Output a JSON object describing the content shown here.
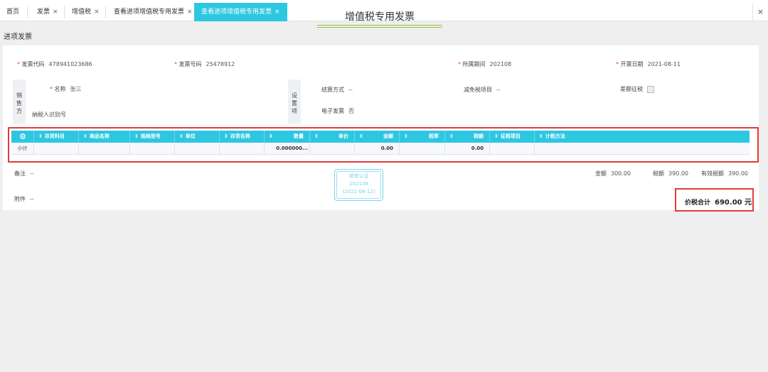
{
  "tabs": [
    {
      "label": "首页"
    },
    {
      "label": "发票"
    },
    {
      "label": "增值税"
    },
    {
      "label": "查看进项增值税专用发票"
    },
    {
      "label": "查看进项增值税专用发票"
    }
  ],
  "close_glyph": "×",
  "page_title": "进项发票",
  "invoice": {
    "title": "增值税专用发票",
    "code_label": "发票代码",
    "code_value": "478941023686",
    "number_label": "发票号码",
    "number_value": "25478912",
    "period_label": "所属期间",
    "period_value": "202108",
    "date_label": "开票日期",
    "date_value": "2021-08-11"
  },
  "seller": {
    "side_label": "销\n售\n方",
    "name_label": "名称",
    "name_value": "张三",
    "taxid_label": "纳税人识别号"
  },
  "settings": {
    "side_label": "设\n置\n项",
    "settle_label": "结算方式",
    "settle_value": "--",
    "exempt_label": "减免税项目",
    "exempt_value": "--",
    "diff_label": "差额征税",
    "einvoice_label": "电子发票",
    "einvoice_value": "否"
  },
  "table": {
    "columns": [
      "存货科目",
      "商品名称",
      "规格型号",
      "单位",
      "存货名称",
      "数量",
      "单价",
      "金额",
      "税率",
      "税额",
      "征税项目",
      "计税方法"
    ],
    "subtotal": {
      "label": "小计",
      "quantity": "0.000000...",
      "amount": "0.00",
      "tax": "0.00"
    }
  },
  "footer": {
    "remark_label": "备注",
    "remark_value": "--",
    "attach_label": "附件",
    "attach_value": "--",
    "amount_label": "金额",
    "amount_value": "300.00",
    "tax_label": "税额",
    "tax_value": "390.00",
    "valid_tax_label": "有效税额",
    "valid_tax_value": "390.00",
    "stamp_line1": "增税认证",
    "stamp_line2": "202108",
    "stamp_line3": "(2021-08-12)",
    "total_label": "价税合计",
    "total_value": "690.00 元"
  },
  "colors": {
    "accent": "#2ec7e1",
    "highlight_border": "#e23b3b",
    "required": "#e74c3c",
    "title_underline": "#9ac43a"
  }
}
